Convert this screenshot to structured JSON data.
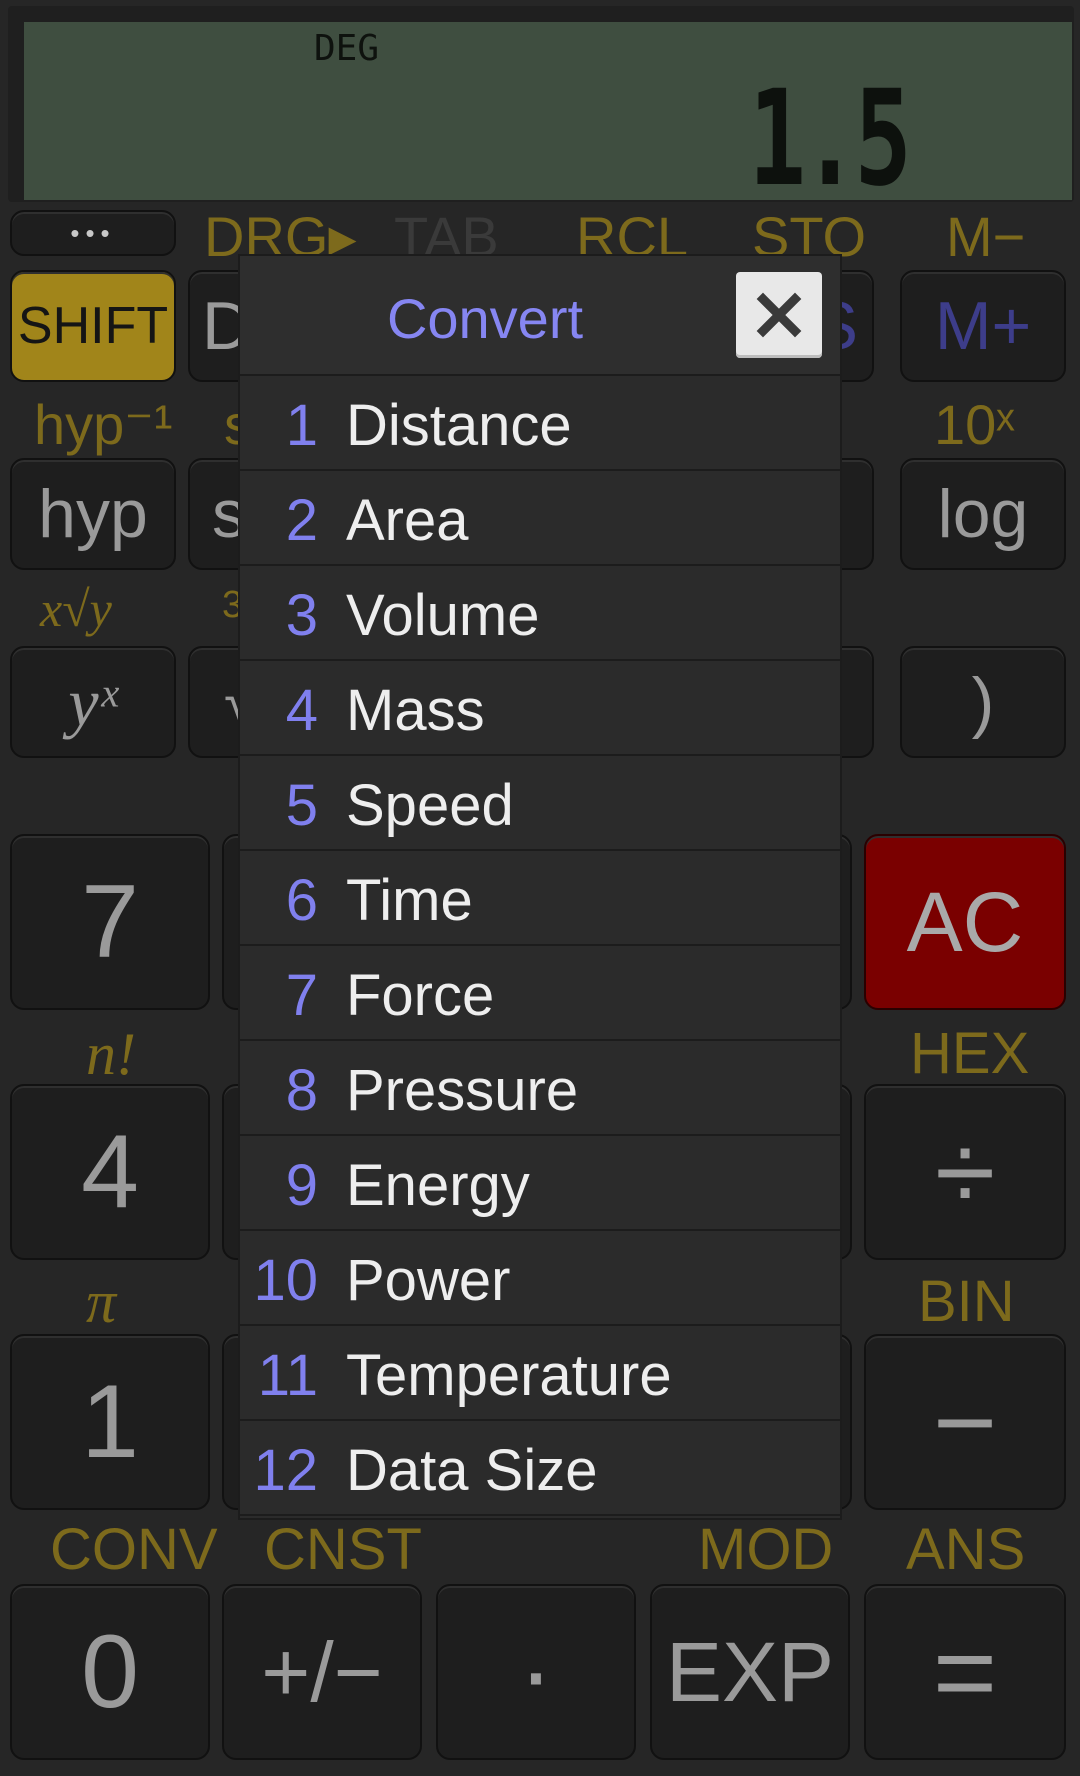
{
  "display": {
    "mode": "DEG",
    "value": "1.5"
  },
  "top_row": {
    "menu_label": "•••",
    "drg": "DRG▸",
    "tab": "TAB",
    "rcl": "RCL",
    "sto": "STO",
    "mminus": "M−"
  },
  "row1": {
    "shift": "SHIFT",
    "d_partial": "D",
    "s_partial": "S",
    "mplus": "M+"
  },
  "row2_fn": {
    "hyp_inv": "hyp⁻¹",
    "s_partial": "s",
    "ten_x": "10ˣ"
  },
  "row2": {
    "hyp": "hyp",
    "s_partial": "s",
    "log": "log"
  },
  "row3_fn": {
    "xroot": "x√y",
    "three_partial": "3"
  },
  "row3": {
    "yx": "yˣ",
    "sqrt_partial": "√",
    "rparen": ")"
  },
  "numpad": {
    "seven": "7",
    "ac": "AC",
    "n_fact": "n!",
    "hex": "HEX",
    "four": "4",
    "divide": "÷",
    "pi": "π",
    "bin": "BIN",
    "one": "1",
    "minus": "−",
    "conv": "CONV",
    "cnst": "CNST",
    "mod": "MOD",
    "ans": "ANS",
    "zero": "0",
    "plusminus": "+/−",
    "dot": "·",
    "exp": "EXP",
    "equals": "="
  },
  "dialog": {
    "title": "Convert",
    "items": [
      {
        "num": "1",
        "label": "Distance"
      },
      {
        "num": "2",
        "label": "Area"
      },
      {
        "num": "3",
        "label": "Volume"
      },
      {
        "num": "4",
        "label": "Mass"
      },
      {
        "num": "5",
        "label": "Speed"
      },
      {
        "num": "6",
        "label": "Time"
      },
      {
        "num": "7",
        "label": "Force"
      },
      {
        "num": "8",
        "label": "Pressure"
      },
      {
        "num": "9",
        "label": "Energy"
      },
      {
        "num": "10",
        "label": "Power"
      },
      {
        "num": "11",
        "label": "Temperature"
      },
      {
        "num": "12",
        "label": "Data Size"
      }
    ]
  },
  "colors": {
    "accent": "#8686f2",
    "function_label": "#7d6a1c",
    "shift_key": "#a1851a",
    "ac_key": "#7a0000",
    "lcd": "#3f4e40"
  }
}
